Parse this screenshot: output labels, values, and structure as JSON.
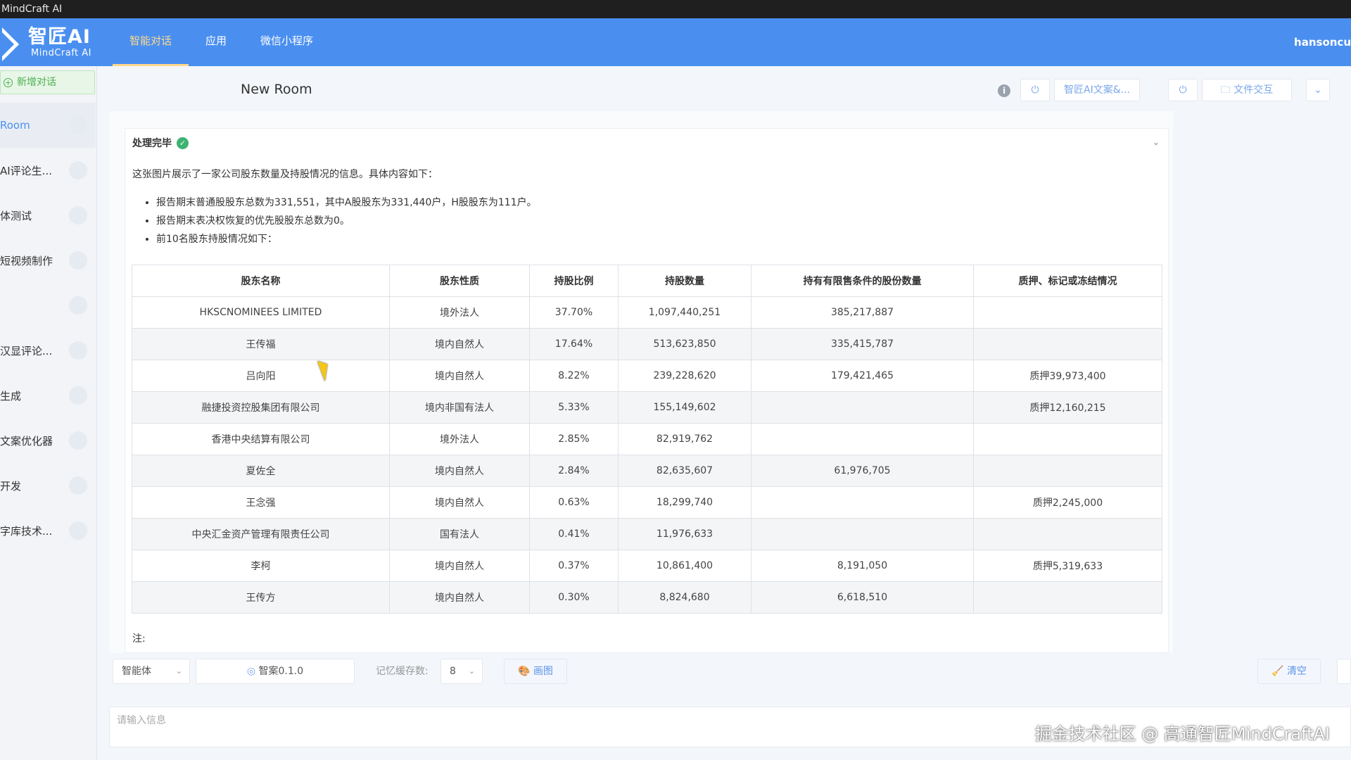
{
  "window": {
    "title": "MindCraft AI"
  },
  "nav": {
    "logo_main": "智匠AI",
    "logo_sub": "MindCraft AI",
    "items": [
      "智能对话",
      "应用",
      "微信小程序"
    ],
    "user": "hansoncu"
  },
  "sidebar": {
    "new_chat": "新增对话",
    "items": [
      "Room",
      "AI评论生...",
      "体测试",
      "短视频制作",
      "",
      "汉显评论...",
      "生成",
      "文案优化器",
      "开发",
      "字库技术..."
    ]
  },
  "room": {
    "title": "New Room",
    "assistant_button": "智匠AI文案&...",
    "file_button": "文件交互"
  },
  "message": {
    "status": "处理完毕",
    "intro": "这张图片展示了一家公司股东数量及持股情况的信息。具体内容如下：",
    "bullets": [
      "报告期末普通股股东总数为331,551，其中A股股东为331,440户，H股股东为111户。",
      "报告期末表决权恢复的优先股股东总数为0。",
      "前10名股东持股情况如下："
    ],
    "table": {
      "headers": [
        "股东名称",
        "股东性质",
        "持股比例",
        "持股数量",
        "持有有限售条件的股份数量",
        "质押、标记或冻结情况"
      ],
      "rows": [
        [
          "HKSCNOMINEES LIMITED",
          "境外法人",
          "37.70%",
          "1,097,440,251",
          "385,217,887",
          ""
        ],
        [
          "王传福",
          "境内自然人",
          "17.64%",
          "513,623,850",
          "335,415,787",
          ""
        ],
        [
          "吕向阳",
          "境内自然人",
          "8.22%",
          "239,228,620",
          "179,421,465",
          "质押39,973,400"
        ],
        [
          "融捷投资控股集团有限公司",
          "境内非国有法人",
          "5.33%",
          "155,149,602",
          "",
          "质押12,160,215"
        ],
        [
          "香港中央结算有限公司",
          "境外法人",
          "2.85%",
          "82,919,762",
          "",
          ""
        ],
        [
          "夏佐全",
          "境内自然人",
          "2.84%",
          "82,635,607",
          "61,976,705",
          ""
        ],
        [
          "王念强",
          "境内自然人",
          "0.63%",
          "18,299,740",
          "",
          "质押2,245,000"
        ],
        [
          "中央汇金资产管理有限责任公司",
          "国有法人",
          "0.41%",
          "11,976,633",
          "",
          ""
        ],
        [
          "李柯",
          "境内自然人",
          "0.37%",
          "10,861,400",
          "8,191,050",
          "质押5,319,633"
        ],
        [
          "王传方",
          "境内自然人",
          "0.30%",
          "8,824,680",
          "6,618,510",
          ""
        ]
      ]
    },
    "note": "注:"
  },
  "toolbar": {
    "agent_select": "智能体",
    "model": "智案0.1.0",
    "memory_label": "记忆缓存数:",
    "memory_value": "8",
    "draw_button": "画图",
    "clear_button": "清空"
  },
  "input": {
    "placeholder": "请输入信息"
  },
  "watermark": "掘金技术社区 @ 高通智匠MindCraftAI",
  "colors": {
    "accent": "#4a8ff0",
    "active_nav": "#ffd98a",
    "success": "#3cb371"
  }
}
